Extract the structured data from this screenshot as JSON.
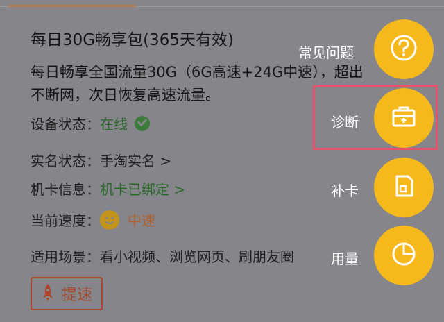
{
  "plan": {
    "title": "每日30G畅享包(365天有效)",
    "desc_line1": "每日畅享全国流量30G（6G高速+24G中速），超出",
    "desc_line2": "不断网，次日恢复高速流量。"
  },
  "rows": {
    "device_status": {
      "label": "设备状态：",
      "value": "在线",
      "icon": "check-circle-icon"
    },
    "realname_status": {
      "label": "实名状态：",
      "value": "手淘实名 >"
    },
    "card_info": {
      "label": "机卡信息：",
      "value": "机卡已绑定 >"
    },
    "current_speed": {
      "label": "当前速度：",
      "value": "中速",
      "icon": "smile-icon"
    },
    "scenarios": {
      "label": "适用场景：",
      "value": "看小视频、浏览网页、刷朋友圈"
    }
  },
  "boost_button": {
    "label": "提速",
    "icon": "rocket-icon"
  },
  "fab_menu": {
    "faq": {
      "label": "常见问题",
      "icon": "question-icon"
    },
    "diagnose": {
      "label": "诊断",
      "icon": "toolbox-icon"
    },
    "replace_card": {
      "label": "补卡",
      "icon": "sim-card-icon"
    },
    "usage": {
      "label": "用量",
      "icon": "pie-chart-icon"
    }
  },
  "colors": {
    "overlay_bg": "#85858b",
    "fab_yellow": "#f5b91c",
    "highlight_border": "#e8506c",
    "status_green": "#2b6a2a",
    "speed_orange": "#b05f2e"
  }
}
